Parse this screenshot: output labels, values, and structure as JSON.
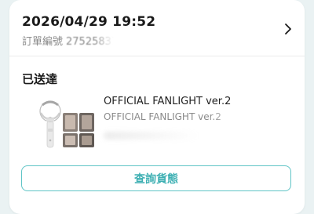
{
  "order": {
    "datetime": "2026/04/29 19:52",
    "number_label": "訂單編號",
    "number_visible": "27525837"
  },
  "shipment": {
    "status": "已送達"
  },
  "item": {
    "name": "OFFICIAL FANLIGHT ver.2",
    "variant": "OFFICIAL FANLIGHT ver.2"
  },
  "actions": {
    "track_label": "查詢貨態"
  },
  "icons": {
    "chevron": "chevron-right-icon",
    "thumbnail": "fanlight-product-thumbnail"
  },
  "colors": {
    "accent": "#5fc4c6",
    "accent_text": "#3eb0b3",
    "background": "#eaf2f3",
    "muted_text": "#8a8a8a"
  }
}
